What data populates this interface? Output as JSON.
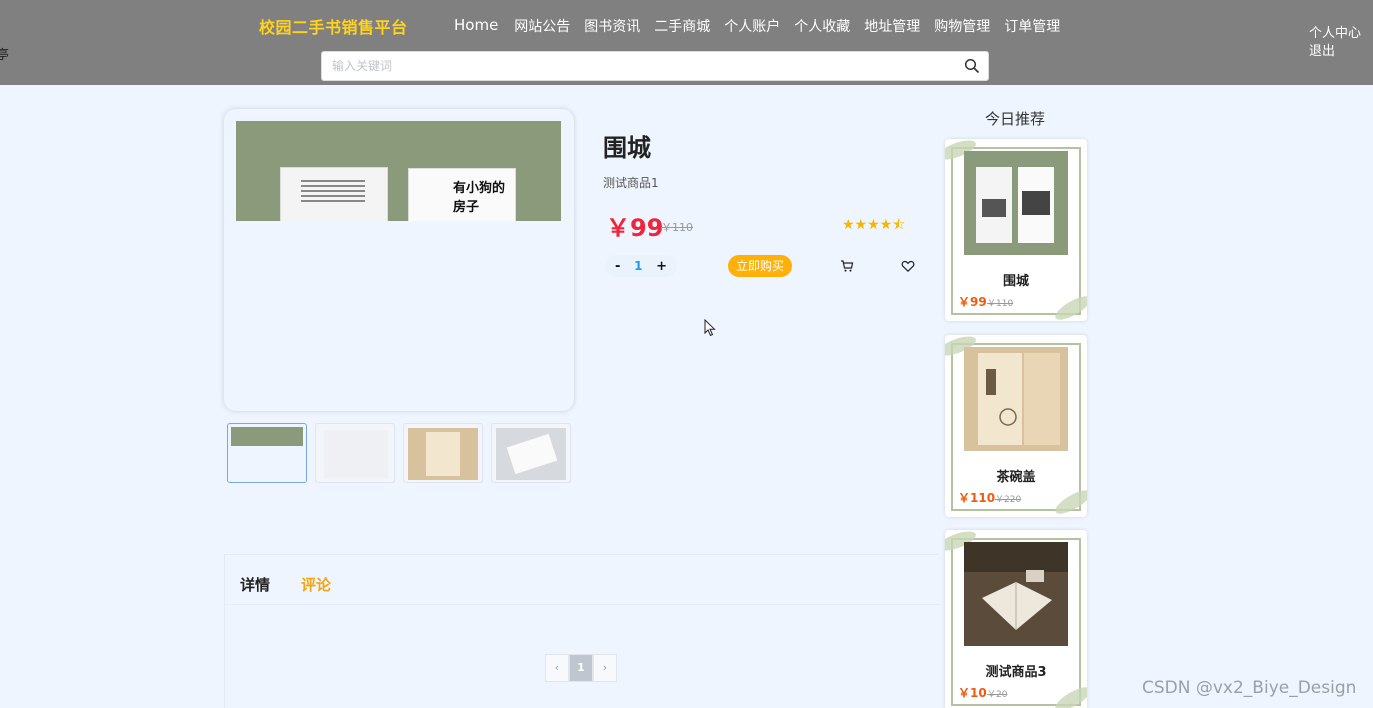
{
  "header": {
    "edge_glyph": "亭",
    "brand": "校园二手书销售平台",
    "nav": [
      "Home",
      "网站公告",
      "图书资讯",
      "二手商城",
      "个人账户",
      "个人收藏",
      "地址管理",
      "购物管理",
      "订单管理"
    ],
    "user_center": "个人中心",
    "logout": "退出",
    "search_placeholder": "输入关键词"
  },
  "product": {
    "title": "围城",
    "subtitle": "测试商品1",
    "price": "￥99",
    "old_price": "￥110",
    "rating": 4.5,
    "stars": "★★★★⯪",
    "quantity": "1",
    "minus": "-",
    "plus": "+",
    "buy_label": "立即购买",
    "main_image_text": "有小狗的房子",
    "thumbnails": [
      "thumb-1",
      "thumb-2",
      "thumb-3",
      "thumb-4"
    ]
  },
  "tabs": {
    "detail": "详情",
    "comment": "评论",
    "active": "comment"
  },
  "pagination": {
    "prev": "‹",
    "current": "1",
    "next": "›"
  },
  "recommend": {
    "title": "今日推荐",
    "items": [
      {
        "name": "围城",
        "price": "￥99",
        "old_price": "￥110"
      },
      {
        "name": "茶碗盖",
        "price": "￥110",
        "old_price": "￥220"
      },
      {
        "name": "测试商品3",
        "price": "￥10",
        "old_price": "￥20"
      }
    ]
  },
  "watermark": "CSDN @vx2_Biye_Design",
  "colors": {
    "header_bg": "#808080",
    "brand": "#ffd21e",
    "price": "#f0243c",
    "accent": "#ffb10a",
    "page_bg": "#eef5fe"
  },
  "icons": [
    "search-icon",
    "cart-icon",
    "heart-icon",
    "cursor-icon"
  ]
}
